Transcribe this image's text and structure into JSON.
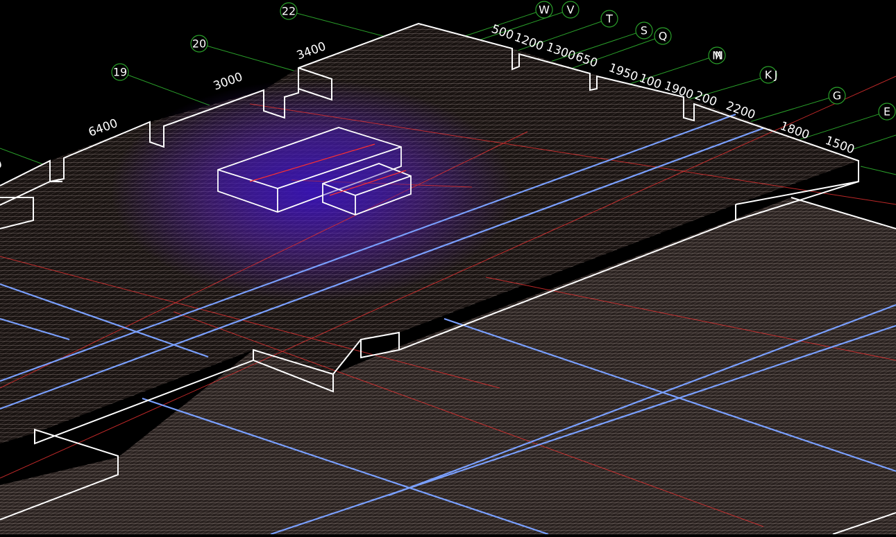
{
  "viewport": {
    "background": "#000000",
    "grid_line_color": "#2aa02a",
    "slab_edge_color": "#ffffff",
    "mesh_color": "#c8b8b0",
    "beam_color": "#7aa0ff",
    "reference_line_color": "#e03030",
    "pit_color": "#3a1aa0"
  },
  "axis_labels": [
    "22",
    "20",
    "19",
    "W",
    "V",
    "T",
    "S",
    "Q",
    "M",
    "N",
    "K",
    "J",
    "G",
    "E"
  ],
  "dimensions": [
    "3400",
    "3000",
    "6400",
    "500",
    "1200",
    "1300",
    "650",
    "1950",
    "100",
    "1900",
    "200",
    "2200",
    "1800",
    "1500"
  ],
  "cut_text": "0"
}
